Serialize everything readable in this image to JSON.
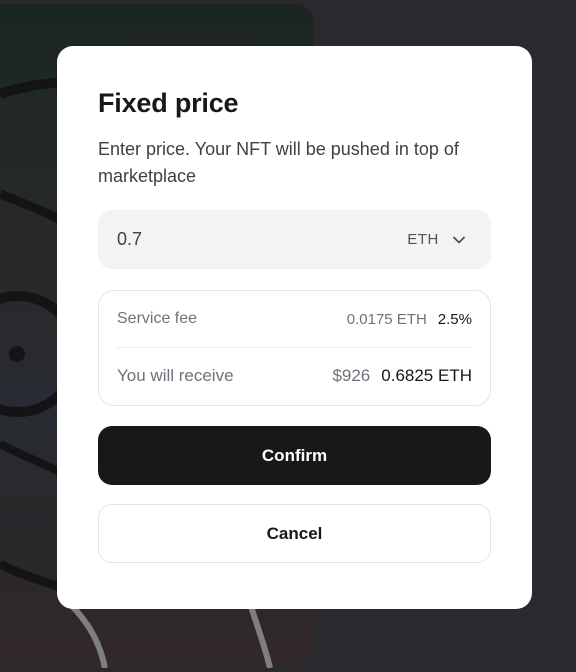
{
  "modal": {
    "title": "Fixed price",
    "description": "Enter price. Your NFT will be pushed in top of marketplace",
    "price_input": {
      "value": "0.7"
    },
    "currency_select": {
      "selected": "ETH",
      "icon": "chevron-down-icon"
    },
    "fees": {
      "service_fee": {
        "label": "Service fee",
        "amount": "0.0175 ETH",
        "percent": "2.5%"
      },
      "receive": {
        "label": "You will receive",
        "usd": "$926",
        "amount": "0.6825 ETH"
      }
    },
    "buttons": {
      "confirm": "Confirm",
      "cancel": "Cancel"
    }
  },
  "colors": {
    "backdrop": "#2a292e",
    "modal_bg": "#ffffff",
    "primary_button": "#18181b",
    "input_bg": "#f3f3f4"
  }
}
